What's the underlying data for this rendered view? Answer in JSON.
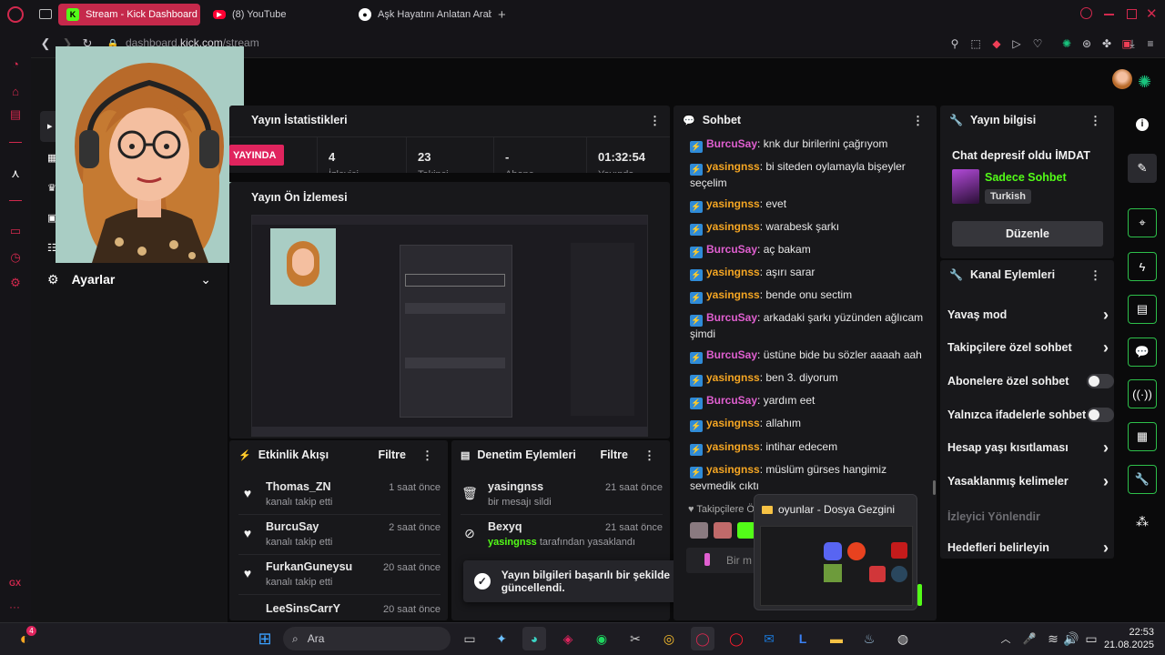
{
  "browser": {
    "tabs": [
      {
        "label": "Stream - Kick Dashboard",
        "icon": "kick-icon"
      },
      {
        "label": "(8) YouTube",
        "icon": "youtube-icon"
      },
      {
        "label": "Aşk Hayatını Anlatan Arab",
        "icon": "document-icon"
      }
    ],
    "url_prefix": "dashboard.",
    "url_domain": "kick.com",
    "url_path": "/stream"
  },
  "sidebar": {
    "settings_label": "Ayarlar"
  },
  "stats": {
    "title": "Yayın İstatistikleri",
    "live_label": "YAYINDA",
    "columns": [
      {
        "value": "4",
        "label": "İzleyici"
      },
      {
        "value": "23",
        "label": "Takipçi"
      },
      {
        "value": "-",
        "label": "Abone"
      },
      {
        "value": "01:32:54",
        "label": "Yayında"
      }
    ]
  },
  "preview": {
    "title": "Yayın Ön İzlemesi"
  },
  "activity": {
    "title": "Etkinlik Akışı",
    "filter": "Filtre",
    "items": [
      {
        "name": "Thomas_ZN",
        "action": "kanalı takip etti",
        "time": "1 saat önce"
      },
      {
        "name": "BurcuSay",
        "action": "kanalı takip etti",
        "time": "2 saat önce"
      },
      {
        "name": "FurkanGuneysu",
        "action": "kanalı takip etti",
        "time": "20 saat önce"
      },
      {
        "name": "LeeSinsCarrY",
        "action": "",
        "time": "20 saat önce"
      }
    ]
  },
  "moderation": {
    "title": "Denetim Eylemleri",
    "filter": "Filtre",
    "items": [
      {
        "name": "yasingnss",
        "action": "bir mesajı sildi",
        "time": "21 saat önce"
      },
      {
        "name": "Bexyq",
        "actor": "yasingnss",
        "action": "tarafından yasaklandı",
        "time": "21 saat önce"
      }
    ]
  },
  "toast": {
    "message": "Yayın bilgileri başarılı bir şekilde güncellendi."
  },
  "chat": {
    "title": "Sohbet",
    "messages": [
      {
        "user": "BurcuSay",
        "text": ": knk dur birilerini çağrıyom"
      },
      {
        "user": "yasingnss",
        "text": ": bi siteden oylamayla bişeyler seçelim"
      },
      {
        "user": "yasingnss",
        "text": ": evet"
      },
      {
        "user": "yasingnss",
        "text": ": warabesk şarkı"
      },
      {
        "user": "BurcuSay",
        "text": ": aç bakam"
      },
      {
        "user": "yasingnss",
        "text": ": aşırı sarar"
      },
      {
        "user": "yasingnss",
        "text": ": bende onu sectim"
      },
      {
        "user": "BurcuSay",
        "text": ": arkadaki şarkı yüzünden ağlıcam şimdi"
      },
      {
        "user": "BurcuSay",
        "text": ": üstüne bide bu sözler aaaah aah"
      },
      {
        "user": "yasingnss",
        "text": ": ben 3. diyorum"
      },
      {
        "user": "BurcuSay",
        "text": ": yardım eet"
      },
      {
        "user": "yasingnss",
        "text": ": allahım"
      },
      {
        "user": "yasingnss",
        "text": ": intihar edecem"
      },
      {
        "user": "yasingnss",
        "text": ": müslüm gürses hangimiz sevmedik cıktı"
      }
    ],
    "followers_label": "Takipçilere Ö",
    "input_placeholder": "Bir m"
  },
  "explorer_popup": {
    "title": "oyunlar - Dosya Gezgini"
  },
  "stream_info": {
    "title": "Yayın bilgisi",
    "stream_title": "Chat depresif oldu İMDAT",
    "category": "Sadece Sohbet",
    "language": "Turkish",
    "edit_label": "Düzenle"
  },
  "channel_actions": {
    "title": "Kanal Eylemleri",
    "items": [
      {
        "label": "Yavaş mod",
        "control": "chevron"
      },
      {
        "label": "Takipçilere özel sohbet",
        "control": "chevron"
      },
      {
        "label": "Abonelere özel sohbet",
        "control": "toggle"
      },
      {
        "label": "Yalnızca ifadelerle sohbet",
        "control": "toggle"
      },
      {
        "label": "Hesap yaşı kısıtlaması",
        "control": "chevron"
      },
      {
        "label": "Yasaklanmış kelimeler",
        "control": "chevron"
      },
      {
        "label": "İzleyici Yönlendir",
        "control": "none"
      },
      {
        "label": "Hedefleri belirleyin",
        "control": "chevron"
      }
    ]
  },
  "taskbar": {
    "search_label": "Ara",
    "time": "22:53",
    "date": "21.08.2025"
  },
  "colors": {
    "kick_green": "#53fc18",
    "opera_red": "#d2294e",
    "chat_user_a": "#f5a623",
    "chat_user_b": "#e05fd0"
  }
}
